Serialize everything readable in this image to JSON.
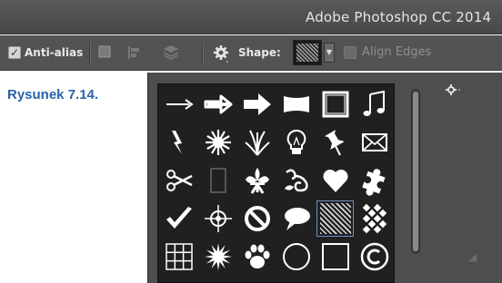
{
  "window": {
    "title": "Adobe Photoshop CC 2014"
  },
  "options_bar": {
    "anti_alias": {
      "label": "Anti-alias",
      "checked": true,
      "check_glyph": "✓"
    },
    "shape_label": "Shape:",
    "align_edges": {
      "label": "Align Edges",
      "checked": false
    },
    "icons": [
      "path-operations-icon",
      "path-alignment-icon",
      "path-arrangement-icon",
      "gear-icon"
    ]
  },
  "caption": "Rysunek 7.14.",
  "shape_picker": {
    "selected_index": 22,
    "accent_color": "#6f8ccc",
    "shapes": [
      "arrow-thin",
      "arrow-medium",
      "arrow-bold",
      "banner",
      "square-frame-grunge",
      "music-notes",
      "lightning",
      "starburst",
      "grass",
      "lightbulb",
      "thumbtack",
      "envelope",
      "scissors",
      "rectangle-frame",
      "fleur-de-lis",
      "ornament",
      "heart",
      "puzzle-piece",
      "checkmark",
      "crosshair",
      "no-sign",
      "speech-bubble",
      "hatched-square",
      "checkerboard",
      "grid",
      "burst",
      "paw-print",
      "circle",
      "square",
      "copyright"
    ]
  }
}
